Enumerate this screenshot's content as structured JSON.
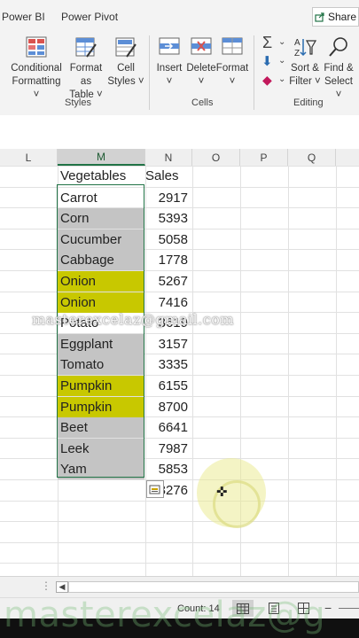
{
  "ribbon": {
    "tabs": [
      "Power BI",
      "Power Pivot"
    ],
    "share_label": "Share",
    "styles_group": {
      "label": "Styles",
      "buttons": [
        {
          "line1": "Conditional",
          "line2": "Formatting ˅"
        },
        {
          "line1": "Format as",
          "line2": "Table ˅"
        },
        {
          "line1": "Cell",
          "line2": "Styles ˅"
        }
      ]
    },
    "cells_group": {
      "label": "Cells",
      "buttons": [
        {
          "line1": "Insert",
          "line2": "˅"
        },
        {
          "line1": "Delete",
          "line2": "˅"
        },
        {
          "line1": "Format",
          "line2": "˅"
        }
      ]
    },
    "editing_group": {
      "label": "Editing",
      "buttons": [
        {
          "line1": "Sort &",
          "line2": "Filter ˅"
        },
        {
          "line1": "Find &",
          "line2": "Select ˅"
        }
      ]
    }
  },
  "columns": [
    "L",
    "M",
    "N",
    "O",
    "P",
    "Q"
  ],
  "table": {
    "headers": [
      "Vegetables",
      "Sales"
    ],
    "rows": [
      {
        "veg": "Carrot",
        "sales": "2917",
        "fill": "none"
      },
      {
        "veg": "Corn",
        "sales": "5393",
        "fill": "gray"
      },
      {
        "veg": "Cucumber",
        "sales": "5058",
        "fill": "gray"
      },
      {
        "veg": "Cabbage",
        "sales": "1778",
        "fill": "gray"
      },
      {
        "veg": "Onion",
        "sales": "5267",
        "fill": "yellow"
      },
      {
        "veg": "Onion",
        "sales": "7416",
        "fill": "yellow"
      },
      {
        "veg": "Potato",
        "sales": "3619",
        "fill": "none"
      },
      {
        "veg": "Eggplant",
        "sales": "3157",
        "fill": "gray"
      },
      {
        "veg": "Tomato",
        "sales": "3335",
        "fill": "gray"
      },
      {
        "veg": "Pumpkin",
        "sales": "6155",
        "fill": "yellow"
      },
      {
        "veg": "Pumpkin",
        "sales": "8700",
        "fill": "yellow"
      },
      {
        "veg": "Beet",
        "sales": "6641",
        "fill": "gray"
      },
      {
        "veg": "Leek",
        "sales": "7987",
        "fill": "gray"
      },
      {
        "veg": "Yam",
        "sales": "5853",
        "fill": "gray"
      }
    ],
    "partial_value": "3276"
  },
  "watermark": {
    "center": "masterexcelaz@gmail.com",
    "bottom": "masterexcelaz@g"
  },
  "status": {
    "count": "Count: 14"
  },
  "colors": {
    "accent": "#217346",
    "gray_fill": "#c4c4c4",
    "yellow_fill": "#c8c800"
  }
}
